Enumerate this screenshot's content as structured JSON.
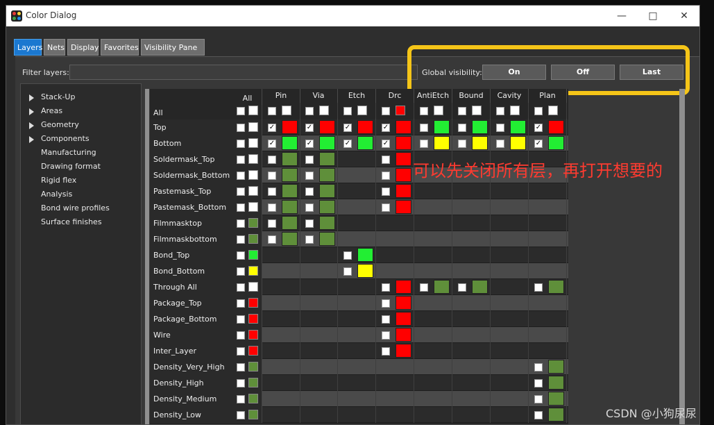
{
  "window": {
    "title": "Color Dialog",
    "min_icon": "minimize-icon",
    "max_icon": "maximize-icon",
    "close_icon": "close-icon"
  },
  "tabs": [
    {
      "label": "Layers",
      "active": true
    },
    {
      "label": "Nets"
    },
    {
      "label": "Display"
    },
    {
      "label": "Favorites"
    },
    {
      "label": "Visibility Pane"
    }
  ],
  "filter": {
    "label": "Filter layers:",
    "value": ""
  },
  "global_visibility": {
    "label": "Global visibility:",
    "on_label": "On",
    "off_label": "Off",
    "last_label": "Last"
  },
  "tree": [
    {
      "label": "Stack-Up",
      "expandable": true
    },
    {
      "label": "Areas",
      "expandable": true
    },
    {
      "label": "Geometry",
      "expandable": true
    },
    {
      "label": "Components",
      "expandable": true
    },
    {
      "label": "Manufacturing"
    },
    {
      "label": "Drawing format"
    },
    {
      "label": "Rigid flex"
    },
    {
      "label": "Analysis"
    },
    {
      "label": "Bond wire profiles"
    },
    {
      "label": "Surface finishes"
    }
  ],
  "columns": [
    "All",
    "Pin",
    "Via",
    "Etch",
    "Drc",
    "AntiEtch",
    "Bound",
    "Cavity",
    "Plan"
  ],
  "colors": {
    "red": "#ff0000",
    "green": "#22ee33",
    "yellow": "#ffff00",
    "olive": "#5f8f3a",
    "highlight": "#f5c518",
    "accent": "#1b78d0"
  },
  "rows": [
    {
      "name": "All",
      "all_swatch": "white",
      "cells": [
        [
          "",
          "white"
        ],
        [
          "",
          "white"
        ],
        [
          "",
          "white"
        ],
        [
          "",
          "red"
        ],
        [
          "",
          "white"
        ],
        [
          "",
          "white"
        ],
        [
          "",
          "white"
        ],
        [
          "",
          "white"
        ]
      ]
    },
    {
      "name": "Top",
      "all_swatch": "white",
      "cells": [
        [
          "x",
          "red"
        ],
        [
          "x",
          "red"
        ],
        [
          "x",
          "red"
        ],
        [
          "x",
          "red"
        ],
        [
          "",
          "green"
        ],
        [
          "",
          "green"
        ],
        [
          "",
          "green"
        ],
        [
          "x",
          "red"
        ]
      ]
    },
    {
      "name": "Bottom",
      "all_swatch": "white",
      "cells": [
        [
          "x",
          "green"
        ],
        [
          "x",
          "green"
        ],
        [
          "x",
          "green"
        ],
        [
          "x",
          "red"
        ],
        [
          "",
          "yellow"
        ],
        [
          "",
          "yellow"
        ],
        [
          "",
          "yellow"
        ],
        [
          "x",
          "green"
        ]
      ]
    },
    {
      "name": "Soldermask_Top",
      "all_swatch": "white",
      "cells": [
        [
          "",
          "olive"
        ],
        [
          "",
          "olive"
        ],
        null,
        [
          "",
          "red"
        ],
        null,
        null,
        null,
        null
      ]
    },
    {
      "name": "Soldermask_Bottom",
      "all_swatch": "white",
      "cells": [
        [
          "",
          "olive"
        ],
        [
          "",
          "olive"
        ],
        null,
        [
          "",
          "red"
        ],
        null,
        null,
        null,
        null
      ]
    },
    {
      "name": "Pastemask_Top",
      "all_swatch": "white",
      "cells": [
        [
          "",
          "olive"
        ],
        [
          "",
          "olive"
        ],
        null,
        [
          "",
          "red"
        ],
        null,
        null,
        null,
        null
      ]
    },
    {
      "name": "Pastemask_Bottom",
      "all_swatch": "white",
      "cells": [
        [
          "",
          "olive"
        ],
        [
          "",
          "olive"
        ],
        null,
        [
          "",
          "red"
        ],
        null,
        null,
        null,
        null
      ]
    },
    {
      "name": "Filmmasktop",
      "all_swatch": "olive",
      "cells": [
        [
          "",
          "olive"
        ],
        [
          "",
          "olive"
        ],
        null,
        null,
        null,
        null,
        null,
        null
      ]
    },
    {
      "name": "Filmmaskbottom",
      "all_swatch": "olive",
      "cells": [
        [
          "",
          "olive"
        ],
        [
          "",
          "olive"
        ],
        null,
        null,
        null,
        null,
        null,
        null
      ]
    },
    {
      "name": "Bond_Top",
      "all_swatch": "green",
      "cells": [
        null,
        null,
        [
          "",
          "green"
        ],
        null,
        null,
        null,
        null,
        null
      ]
    },
    {
      "name": "Bond_Bottom",
      "all_swatch": "yellow",
      "cells": [
        null,
        null,
        [
          "",
          "yellow"
        ],
        null,
        null,
        null,
        null,
        null
      ]
    },
    {
      "name": "Through All",
      "all_swatch": "white",
      "cells": [
        null,
        null,
        null,
        [
          "",
          "red"
        ],
        [
          "",
          "olive"
        ],
        [
          "",
          "olive"
        ],
        null,
        [
          "",
          "olive"
        ]
      ]
    },
    {
      "name": "Package_Top",
      "all_swatch": "red",
      "cells": [
        null,
        null,
        null,
        [
          "",
          "red"
        ],
        null,
        null,
        null,
        null
      ]
    },
    {
      "name": "Package_Bottom",
      "all_swatch": "red",
      "cells": [
        null,
        null,
        null,
        [
          "",
          "red"
        ],
        null,
        null,
        null,
        null
      ]
    },
    {
      "name": "Wire",
      "all_swatch": "red",
      "cells": [
        null,
        null,
        null,
        [
          "",
          "red"
        ],
        null,
        null,
        null,
        null
      ]
    },
    {
      "name": "Inter_Layer",
      "all_swatch": "red",
      "cells": [
        null,
        null,
        null,
        [
          "",
          "red"
        ],
        null,
        null,
        null,
        null
      ]
    },
    {
      "name": "Density_Very_High",
      "all_swatch": "olive",
      "cells": [
        null,
        null,
        null,
        null,
        null,
        null,
        null,
        [
          "",
          "olive"
        ]
      ]
    },
    {
      "name": "Density_High",
      "all_swatch": "olive",
      "cells": [
        null,
        null,
        null,
        null,
        null,
        null,
        null,
        [
          "",
          "olive"
        ]
      ]
    },
    {
      "name": "Density_Medium",
      "all_swatch": "olive",
      "cells": [
        null,
        null,
        null,
        null,
        null,
        null,
        null,
        [
          "",
          "olive"
        ]
      ]
    },
    {
      "name": "Density_Low",
      "all_swatch": "olive",
      "cells": [
        null,
        null,
        null,
        null,
        null,
        null,
        null,
        [
          "",
          "olive"
        ]
      ]
    }
  ],
  "annotation": "可以先关闭所有层，再打开想要的",
  "watermark": "CSDN @小狗尿尿"
}
